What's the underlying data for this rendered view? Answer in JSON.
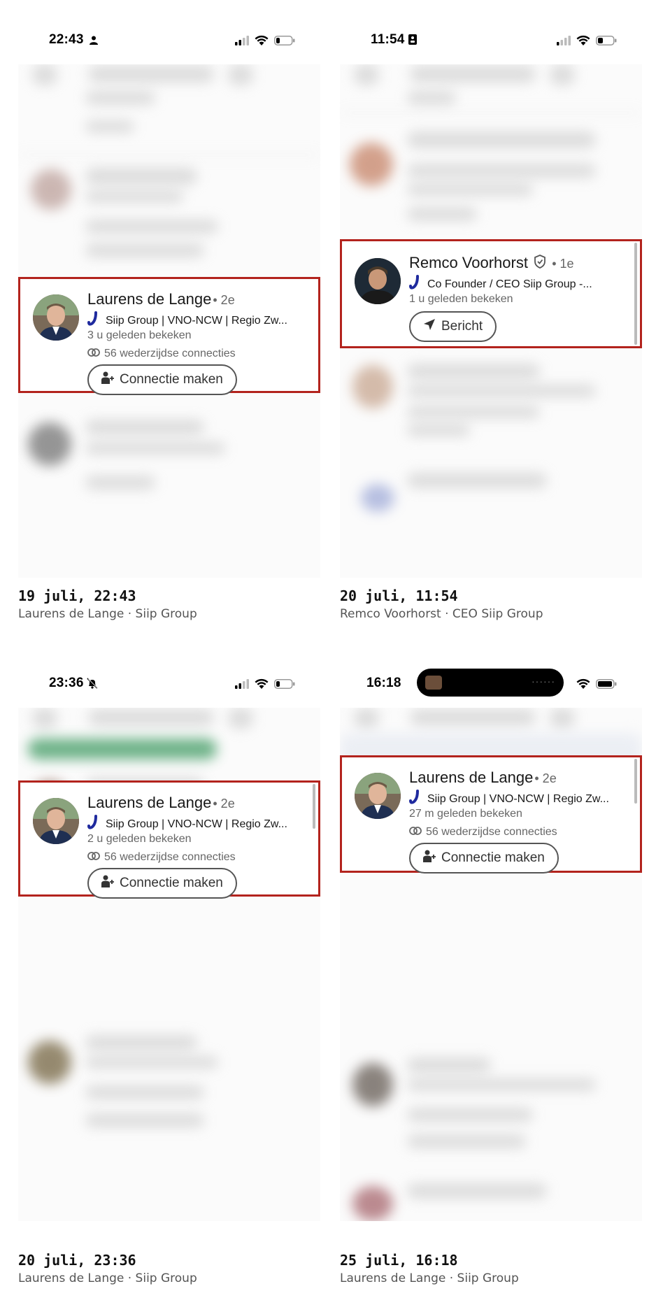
{
  "panels": [
    {
      "status": {
        "time": "22:43",
        "indicator_icon": "person-icon",
        "battery_level": 0.2
      },
      "card": {
        "name": "Laurens de Lange",
        "degree": "• 2e",
        "company": "Siip Group | VNO-NCW | Regio Zw...",
        "viewed": "3 u geleden bekeken",
        "mutual": "56 wederzijdse connecties",
        "button": "Connectie maken",
        "button_icon": "add-person-icon"
      },
      "caption": {
        "date": "19 juli, 22:43",
        "sub": "Laurens de Lange · Siip Group"
      }
    },
    {
      "status": {
        "time": "11:54",
        "indicator_icon": "id-card-icon",
        "battery_level": 0.3
      },
      "card": {
        "name": "Remco Voorhorst",
        "degree": "• 1e",
        "company": "Co Founder / CEO Siip Group -...",
        "viewed": "1 u geleden bekeken",
        "button": "Bericht",
        "button_icon": "send-icon",
        "verified_icon": "verified-shield-icon"
      },
      "caption": {
        "date": "20 juli, 11:54",
        "sub": "Remco Voorhorst · CEO Siip Group"
      }
    },
    {
      "status": {
        "time": "23:36",
        "indicator_icon": "bell-muted-icon",
        "battery_level": 0.2
      },
      "card": {
        "name": "Laurens de Lange",
        "degree": "• 2e",
        "company": "Siip Group | VNO-NCW | Regio Zw...",
        "viewed": "2 u geleden bekeken",
        "mutual": "56 wederzijdse connecties",
        "button": "Connectie maken",
        "button_icon": "add-person-icon"
      },
      "caption": {
        "date": "20 juli, 23:36",
        "sub": "Laurens de Lange · Siip Group"
      }
    },
    {
      "status": {
        "time": "16:18",
        "indicator_icon": "dynamic-island",
        "battery_level": 1.0
      },
      "card": {
        "name": "Laurens de Lange",
        "degree": "• 2e",
        "company": "Siip Group | VNO-NCW | Regio Zw...",
        "viewed": "27 m geleden bekeken",
        "mutual": "56 wederzijdse connecties",
        "button": "Connectie maken",
        "button_icon": "add-person-icon"
      },
      "caption": {
        "date": "25 juli, 16:18",
        "sub": "Laurens de Lange · Siip Group"
      }
    }
  ],
  "colors": {
    "highlight_border": "#b3231d",
    "brand_logo": "#1f2a9e",
    "blur_green": "#3f9a62"
  }
}
